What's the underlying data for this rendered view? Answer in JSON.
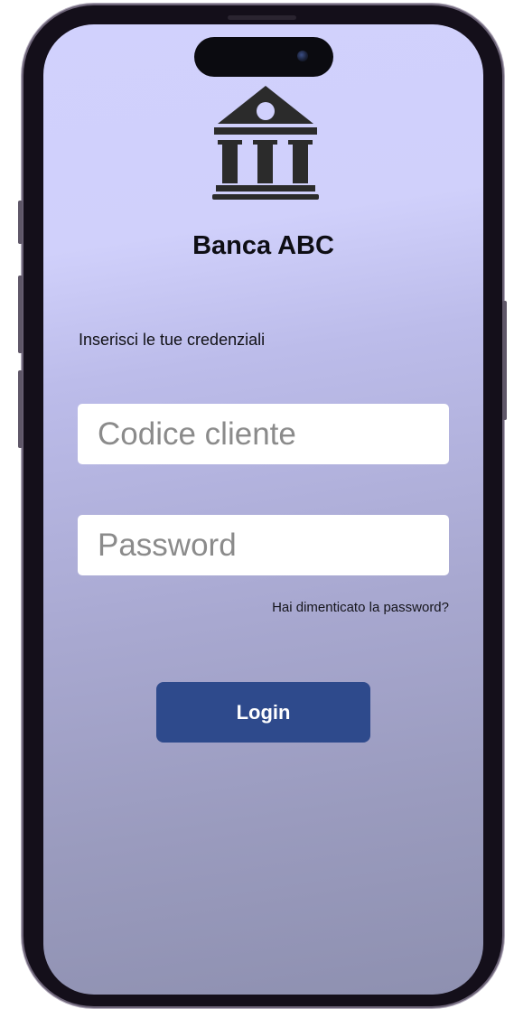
{
  "app": {
    "bank_name": "Banca ABC",
    "logo_icon": "bank-building-icon"
  },
  "login": {
    "instruction": "Inserisci le tue credenziali",
    "client_code_placeholder": "Codice cliente",
    "password_placeholder": "Password",
    "forgot_password_label": "Hai dimenticato la password?",
    "login_button_label": "Login"
  },
  "colors": {
    "background_top": "#d1d1fd",
    "background_bottom": "#8e90b0",
    "login_button": "#2e4a8c",
    "text": "#0e0e14",
    "phone_frame": "#140f1a"
  }
}
